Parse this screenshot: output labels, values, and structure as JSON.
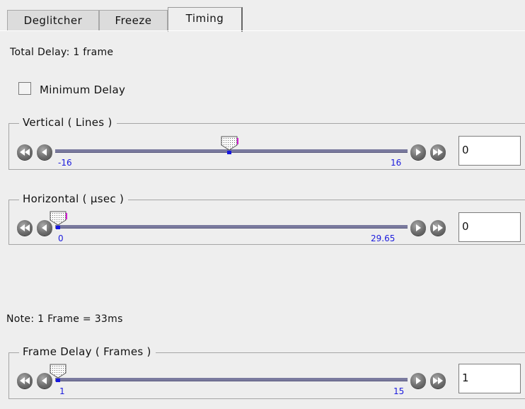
{
  "tabs": [
    {
      "label": "Deglitcher",
      "active": false
    },
    {
      "label": "Freeze",
      "active": false
    },
    {
      "label": "Timing",
      "active": true
    }
  ],
  "total_delay": "Total Delay: 1 frame",
  "minimum_delay": {
    "label": "Minimum Delay",
    "checked": false
  },
  "vertical": {
    "title": "Vertical ( Lines )",
    "min_label": "-16",
    "max_label": "16",
    "min": -16,
    "max": 16,
    "value": 0,
    "field": "0"
  },
  "horizontal": {
    "title": "Horizontal ( µsec )",
    "min_label": "0",
    "max_label": "29.65",
    "min": 0,
    "max": 29.65,
    "value": 0,
    "field": "0"
  },
  "note": "Note: 1 Frame = 33ms",
  "frame_delay": {
    "title": "Frame Delay ( Frames )",
    "min_label": "1",
    "max_label": "15",
    "min": 1,
    "max": 15,
    "value": 1,
    "field": "1"
  },
  "icons": [
    "double-left-arrow-icon",
    "left-arrow-icon",
    "right-arrow-icon",
    "double-right-arrow-icon",
    "slider-thumb-icon"
  ],
  "colors": {
    "tick_label": "#1c1cdd",
    "track": "#7a7a9e",
    "background": "#eeeeee"
  }
}
